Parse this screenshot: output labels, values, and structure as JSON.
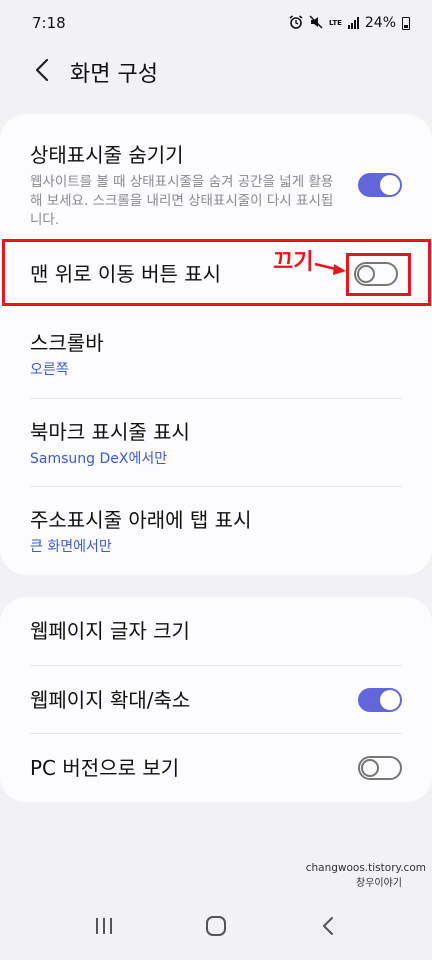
{
  "status_bar": {
    "time": "7:18",
    "lte": "LTE",
    "battery": "24%"
  },
  "header": {
    "title": "화면 구성"
  },
  "settings_group_1": [
    {
      "title": "상태표시줄 숨기기",
      "description": "웹사이트를 볼 때 상태표시줄을 숨겨 공간을 넓게 활용해 보세요. 스크롤을 내리면 상태표시줄이 다시 표시됩니다.",
      "toggle": "on"
    },
    {
      "title": "맨 위로 이동 버튼 표시",
      "toggle": "off"
    },
    {
      "title": "스크롤바",
      "subtitle": "오른쪽"
    },
    {
      "title": "북마크 표시줄 표시",
      "subtitle": "Samsung DeX에서만"
    },
    {
      "title": "주소표시줄 아래에 탭 표시",
      "subtitle": "큰 화면에서만"
    }
  ],
  "settings_group_2": [
    {
      "title": "웹페이지 글자 크기"
    },
    {
      "title": "웹페이지 확대/축소",
      "toggle": "on"
    },
    {
      "title": "PC 버전으로 보기",
      "toggle": "off"
    }
  ],
  "annotation": {
    "label": "끄기",
    "color": "#e8141e"
  },
  "watermark": {
    "line1": "changwoos.tistory.com",
    "line2": "창우이야기"
  },
  "colors": {
    "accent": "#6166d9",
    "link_blue": "#3c5bd2",
    "background": "#f2f2f6",
    "card": "#fcfcfe"
  },
  "icons": {
    "back": "chevron-left-icon",
    "nav_recent": "recent-apps-icon",
    "nav_home": "home-icon",
    "nav_back": "back-icon"
  }
}
